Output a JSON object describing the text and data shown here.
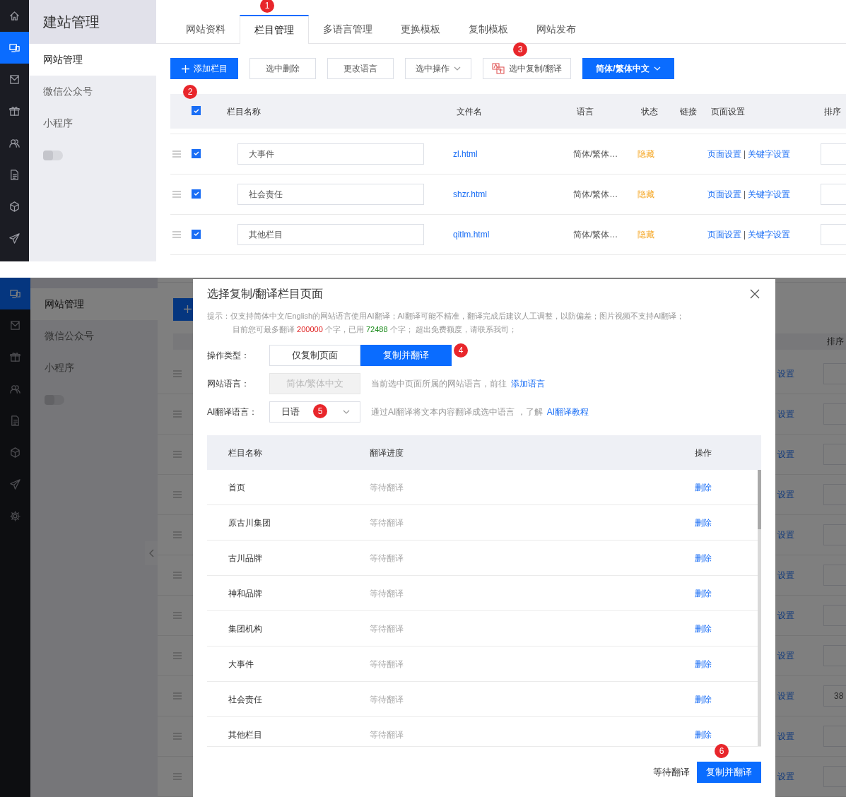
{
  "top": {
    "rail": [
      {
        "selected": false
      },
      {
        "selected": true
      },
      {
        "selected": false
      },
      {
        "selected": false
      },
      {
        "selected": false
      },
      {
        "selected": false
      },
      {
        "selected": false
      },
      {
        "selected": false
      }
    ],
    "sidebar": {
      "title": "建站管理",
      "items": [
        {
          "label": "网站管理",
          "selected": true
        },
        {
          "label": "微信公众号",
          "selected": false
        },
        {
          "label": "小程序",
          "selected": false
        }
      ],
      "toggle": {
        "on": false
      }
    },
    "tabs": [
      {
        "label": "网站资料",
        "selected": false
      },
      {
        "label": "栏目管理",
        "selected": true
      },
      {
        "label": "多语言管理",
        "selected": false
      },
      {
        "label": "更换模板",
        "selected": false
      },
      {
        "label": "复制模板",
        "selected": false
      },
      {
        "label": "网站发布",
        "selected": false
      }
    ],
    "toolbar": [
      {
        "kind": "add",
        "label": "添加栏目"
      },
      {
        "kind": "plain",
        "label": "选中删除"
      },
      {
        "kind": "plain",
        "label": "更改语言"
      },
      {
        "kind": "menu",
        "label": "选中操作"
      },
      {
        "kind": "translate",
        "label": "选中复制/翻译"
      },
      {
        "kind": "language",
        "label": "简体/繁体中文"
      }
    ],
    "table": {
      "all_checked": true,
      "columns": [
        "栏目名称",
        "文件名",
        "语言",
        "状态",
        "链接",
        "页面设置",
        "排序"
      ],
      "rows": [
        {
          "checked": true,
          "name": "大事件",
          "file": "zl.html",
          "language": "简体/繁体…",
          "status": "隐藏",
          "page_link": "页面设置",
          "separator": "|",
          "keyword_link": "关键字设置"
        },
        {
          "checked": true,
          "name": "社会责任",
          "file": "shzr.html",
          "language": "简体/繁体…",
          "status": "隐藏",
          "page_link": "页面设置",
          "separator": "|",
          "keyword_link": "关键字设置"
        },
        {
          "checked": true,
          "name": "其他栏目",
          "file": "qitlm.html",
          "language": "简体/繁体…",
          "status": "隐藏",
          "page_link": "页面设置",
          "separator": "|",
          "keyword_link": "关键字设置"
        }
      ]
    }
  },
  "bottom": {
    "rail": [
      {
        "selected": true
      },
      {
        "selected": false
      },
      {
        "selected": false
      },
      {
        "selected": false
      },
      {
        "selected": false
      },
      {
        "selected": false
      },
      {
        "selected": false
      },
      {
        "selected": false
      }
    ],
    "sidebar": {
      "items": [
        {
          "label": "网站管理",
          "selected": true
        },
        {
          "label": "微信公众号",
          "selected": false
        },
        {
          "label": "小程序",
          "selected": false
        }
      ],
      "toggle": {
        "on": false
      }
    },
    "sort_header": "排序",
    "rows": [
      {
        "link_fragment": "设置"
      },
      {
        "link_fragment": "设置"
      },
      {
        "link_fragment": "设置"
      },
      {
        "link_fragment": "设置"
      },
      {
        "link_fragment": "设置"
      },
      {
        "link_fragment": "设置"
      },
      {
        "link_fragment": "设置"
      },
      {
        "link_fragment": "设置"
      },
      {
        "link_fragment": "设置",
        "sort": "38"
      },
      {
        "link_fragment": "设置"
      },
      {
        "link_fragment": "设置"
      }
    ],
    "modal": {
      "title": "选择复制/翻译栏目页面",
      "hint_line1": "提示：仅支持简体中文/English的网站语言使用AI翻译；AI翻译可能不精准，翻译完成后建议人工调整，以防偏差；图片视频不支持AI翻译；",
      "hint_line2": {
        "prefix": "目前您可最多翻译 ",
        "limit": "200000",
        "middle": " 个字，已用 ",
        "used": "72488",
        "suffix": " 个字； 超出免费额度，请联系我司；"
      },
      "operation": {
        "label": "操作类型：",
        "options": [
          {
            "label": "仅复制页面",
            "selected": false
          },
          {
            "label": "复制并翻译",
            "selected": true
          }
        ]
      },
      "website_language": {
        "label": "网站语言：",
        "value": "简体/繁体中文",
        "disabled": true,
        "help": "当前选中页面所属的网站语言，前往",
        "link": "添加语言"
      },
      "ai_language": {
        "label": "AI翻译语言：",
        "value": "日语",
        "help": "通过AI翻译将文本内容翻译成选中语言 ，了解",
        "link": "AI翻译教程"
      },
      "columns": [
        "栏目名称",
        "翻译进度",
        "操作"
      ],
      "rows": [
        {
          "name": "首页",
          "progress": "等待翻译",
          "action": "删除"
        },
        {
          "name": "原古川集团",
          "progress": "等待翻译",
          "action": "删除"
        },
        {
          "name": "古川品牌",
          "progress": "等待翻译",
          "action": "删除"
        },
        {
          "name": "神和品牌",
          "progress": "等待翻译",
          "action": "删除"
        },
        {
          "name": "集团机构",
          "progress": "等待翻译",
          "action": "删除"
        },
        {
          "name": "大事件",
          "progress": "等待翻译",
          "action": "删除"
        },
        {
          "name": "社会责任",
          "progress": "等待翻译",
          "action": "删除"
        },
        {
          "name": "其他栏目",
          "progress": "等待翻译",
          "action": "删除"
        }
      ],
      "footer_status": "等待翻译",
      "submit": "复制并翻译"
    }
  },
  "annotations": [
    {
      "label": "1"
    },
    {
      "label": "2"
    },
    {
      "label": "3"
    },
    {
      "label": "4"
    },
    {
      "label": "5"
    },
    {
      "label": "6"
    }
  ]
}
